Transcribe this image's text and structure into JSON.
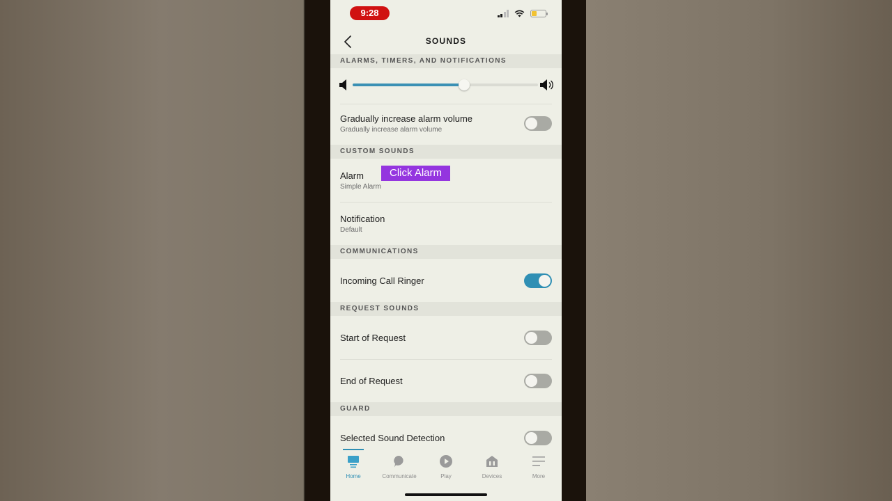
{
  "status": {
    "time": "9:28"
  },
  "header": {
    "title": "SOUNDS"
  },
  "sections": {
    "alarms": "ALARMS, TIMERS, AND NOTIFICATIONS",
    "custom": "CUSTOM SOUNDS",
    "communications": "COMMUNICATIONS",
    "request": "REQUEST SOUNDS",
    "guard": "GUARD"
  },
  "volume": {
    "level": 0.6
  },
  "rows": {
    "gradual": {
      "title": "Gradually increase alarm volume",
      "subtitle": "Gradually increase alarm volume",
      "on": false
    },
    "alarm": {
      "title": "Alarm",
      "subtitle": "Simple Alarm"
    },
    "notification": {
      "title": "Notification",
      "subtitle": "Default"
    },
    "call_ringer": {
      "title": "Incoming Call Ringer",
      "on": true
    },
    "start_request": {
      "title": "Start of Request",
      "on": false
    },
    "end_request": {
      "title": "End of Request",
      "on": false
    },
    "sound_detection": {
      "title": "Selected Sound Detection",
      "on": false
    }
  },
  "callout": "Click Alarm",
  "tabs": [
    {
      "label": "Home",
      "icon": "home-icon",
      "active": true
    },
    {
      "label": "Communicate",
      "icon": "chat-bubble-icon",
      "active": false
    },
    {
      "label": "Play",
      "icon": "play-icon",
      "active": false
    },
    {
      "label": "Devices",
      "icon": "devices-icon",
      "active": false
    },
    {
      "label": "More",
      "icon": "menu-icon",
      "active": false
    }
  ],
  "colors": {
    "accent": "#2f8fb4",
    "callout": "#9435df",
    "time_pill": "#d01111"
  }
}
